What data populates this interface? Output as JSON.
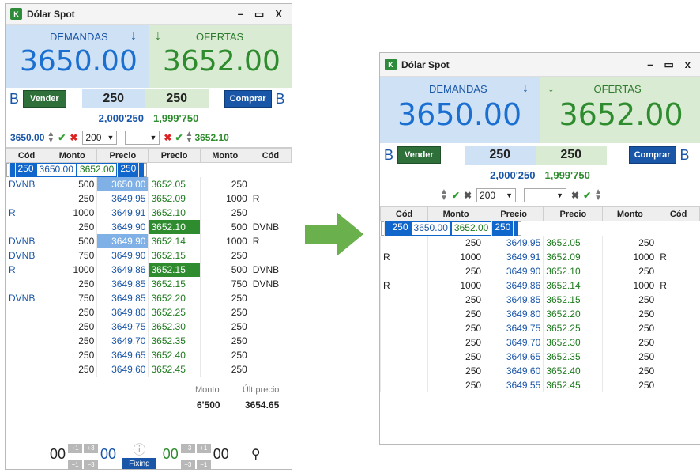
{
  "colors": {
    "blue": "#1a56a8",
    "green": "#2e8b2e",
    "select": "#1166cc",
    "arrow": "#6ab04c"
  },
  "left": {
    "title": "Dólar Spot",
    "win_ctrl": [
      "–",
      "▭",
      "X"
    ],
    "demand_header": "DEMANDAS",
    "offer_header": "OFERTAS",
    "demand_price": "3650.00",
    "offer_price": "3652.00",
    "b_left": "B",
    "b_right": "B",
    "sell_label": "Vender",
    "buy_label": "Comprar",
    "sell_qty": "250",
    "buy_qty": "250",
    "demand_total": "2,000'250",
    "offer_total": "1,999'750",
    "bid_ctl_price": "3650.00",
    "bid_ctl_qty": "200",
    "ask_ctl_price": "3652.10",
    "headers": [
      "Cód",
      "Monto",
      "Precio",
      "Precio",
      "Monto",
      "Cód"
    ],
    "rows": [
      [
        "",
        "250",
        "3650.00",
        "3652.00",
        "250",
        ""
      ],
      [
        "DVNB",
        "500",
        "3650.00",
        "3652.05",
        "250",
        ""
      ],
      [
        "",
        "250",
        "3649.95",
        "3652.09",
        "1000",
        "R"
      ],
      [
        "R",
        "1000",
        "3649.91",
        "3652.10",
        "250",
        ""
      ],
      [
        "",
        "250",
        "3649.90",
        "3652.10",
        "500",
        "DVNB"
      ],
      [
        "DVNB",
        "500",
        "3649.90",
        "3652.14",
        "1000",
        "R"
      ],
      [
        "DVNB",
        "750",
        "3649.90",
        "3652.15",
        "250",
        ""
      ],
      [
        "R",
        "1000",
        "3649.86",
        "3652.15",
        "500",
        "DVNB"
      ],
      [
        "",
        "250",
        "3649.85",
        "3652.15",
        "750",
        "DVNB"
      ],
      [
        "DVNB",
        "750",
        "3649.85",
        "3652.20",
        "250",
        ""
      ],
      [
        "",
        "250",
        "3649.80",
        "3652.25",
        "250",
        ""
      ],
      [
        "",
        "250",
        "3649.75",
        "3652.30",
        "250",
        ""
      ],
      [
        "",
        "250",
        "3649.70",
        "3652.35",
        "250",
        ""
      ],
      [
        "",
        "250",
        "3649.65",
        "3652.40",
        "250",
        ""
      ],
      [
        "",
        "250",
        "3649.60",
        "3652.45",
        "250",
        ""
      ]
    ],
    "stats": {
      "monto_label": "Monto",
      "ult_label": "Últ.precio",
      "monto": "6'500",
      "ult": "3654.65"
    },
    "fixing": {
      "left": "00",
      "left2": "00",
      "right": "00",
      "right2": "00",
      "label": "Fixing",
      "plus1": "+1",
      "plus3": "+3",
      "minus1": "−1",
      "minus3": "−3"
    }
  },
  "right": {
    "title": "Dólar Spot",
    "win_ctrl": [
      "–",
      "▭",
      "x"
    ],
    "demand_header": "DEMANDAS",
    "offer_header": "OFERTAS",
    "demand_price": "3650.00",
    "offer_price": "3652.00",
    "b_left": "B",
    "b_right": "B",
    "sell_label": "Vender",
    "buy_label": "Comprar",
    "sell_qty": "250",
    "buy_qty": "250",
    "demand_total": "2,000'250",
    "offer_total": "1,999'750",
    "bid_ctl_qty": "200",
    "headers": [
      "Cód",
      "Monto",
      "Precio",
      "Precio",
      "Monto",
      "Cód"
    ],
    "rows": [
      [
        "",
        "250",
        "3650.00",
        "3652.00",
        "250",
        ""
      ],
      [
        "",
        "250",
        "3649.95",
        "3652.05",
        "250",
        ""
      ],
      [
        "R",
        "1000",
        "3649.91",
        "3652.09",
        "1000",
        "R"
      ],
      [
        "",
        "250",
        "3649.90",
        "3652.10",
        "250",
        ""
      ],
      [
        "R",
        "1000",
        "3649.86",
        "3652.14",
        "1000",
        "R"
      ],
      [
        "",
        "250",
        "3649.85",
        "3652.15",
        "250",
        ""
      ],
      [
        "",
        "250",
        "3649.80",
        "3652.20",
        "250",
        ""
      ],
      [
        "",
        "250",
        "3649.75",
        "3652.25",
        "250",
        ""
      ],
      [
        "",
        "250",
        "3649.70",
        "3652.30",
        "250",
        ""
      ],
      [
        "",
        "250",
        "3649.65",
        "3652.35",
        "250",
        ""
      ],
      [
        "",
        "250",
        "3649.60",
        "3652.40",
        "250",
        ""
      ],
      [
        "",
        "250",
        "3649.55",
        "3652.45",
        "250",
        ""
      ]
    ]
  }
}
